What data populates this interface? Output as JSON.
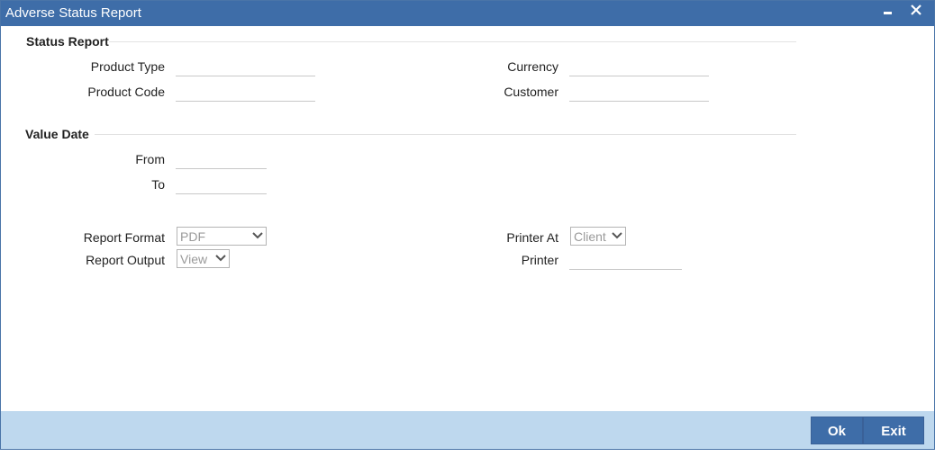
{
  "window": {
    "title": "Adverse Status Report",
    "minimize_icon": "minimize-icon",
    "close_icon": "close-icon"
  },
  "status_report": {
    "section_title": "Status Report",
    "product_type_label": "Product Type",
    "product_type_value": "",
    "product_code_label": "Product Code",
    "product_code_value": "",
    "currency_label": "Currency",
    "currency_value": "",
    "customer_label": "Customer",
    "customer_value": ""
  },
  "value_date": {
    "section_title": "Value Date",
    "from_label": "From",
    "from_value": "",
    "to_label": "To",
    "to_value": ""
  },
  "report": {
    "format_label": "Report Format",
    "format_value": "PDF",
    "output_label": "Report Output",
    "output_value": "View",
    "printer_at_label": "Printer At",
    "printer_at_value": "Client",
    "printer_label": "Printer",
    "printer_value": ""
  },
  "footer": {
    "ok_label": "Ok",
    "exit_label": "Exit"
  },
  "colors": {
    "titlebar": "#3e6da8",
    "footer": "#bed8ee",
    "button": "#3e6da8"
  }
}
